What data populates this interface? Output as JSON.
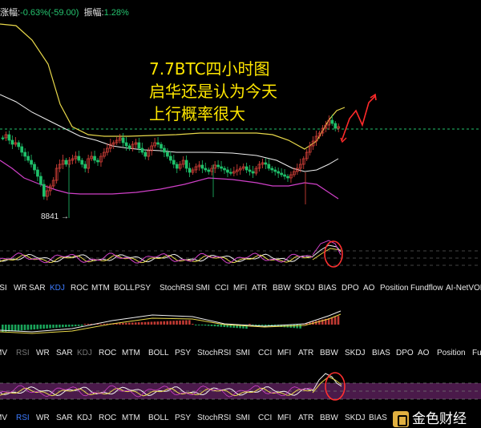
{
  "header": {
    "change_label": "涨幅:",
    "change_value": "-0.63%(-59.00)",
    "amplitude_label": "振幅:",
    "amplitude_value": "1.28%"
  },
  "annotation": {
    "line1": "7.7BTC四小时图",
    "line2": "启华还是认为今天",
    "line3": "上行概率很大"
  },
  "price_label": "8841",
  "tabbar1": [
    "RSI",
    "WR",
    "SAR",
    "KDJ",
    "ROC",
    "MTM",
    "BOLL",
    "PSY",
    "StochRSI",
    "SMI",
    "CCI",
    "MFI",
    "ATR",
    "BBW",
    "SKDJ",
    "BIAS",
    "DPO",
    "AO",
    "Position",
    "Fundflow",
    "AI-NetVOL"
  ],
  "tabbar1_active": "KDJ",
  "tabbar2": [
    "MV",
    "RSI",
    "WR",
    "SAR",
    "KDJ",
    "ROC",
    "MTM",
    "BOLL",
    "PSY",
    "StochRSI",
    "SMI",
    "CCI",
    "MFI",
    "ATR",
    "BBW",
    "SKDJ",
    "BIAS",
    "DPO",
    "AO",
    "Position",
    "Fu"
  ],
  "tabbar2_dim": [
    "RSI",
    "KDJ"
  ],
  "tabbar3": [
    "MV",
    "RSI",
    "WR",
    "SAR",
    "KDJ",
    "ROC",
    "MTM",
    "BOLL",
    "PSY",
    "StochRSI",
    "SMI",
    "CCI",
    "MFI",
    "ATR",
    "BBW",
    "SKDJ",
    "BIAS"
  ],
  "tabbar3_active": "RSI",
  "watermark": "金色财经",
  "colors": {
    "up": "#e2443c",
    "down": "#1fc06a",
    "boll_upper": "#e8d84a",
    "boll_mid": "#f0f0f0",
    "boll_lower": "#d040c8",
    "highlight": "#ff3030",
    "annotation": "#ffe600",
    "tab_active": "#3d7bff"
  }
}
